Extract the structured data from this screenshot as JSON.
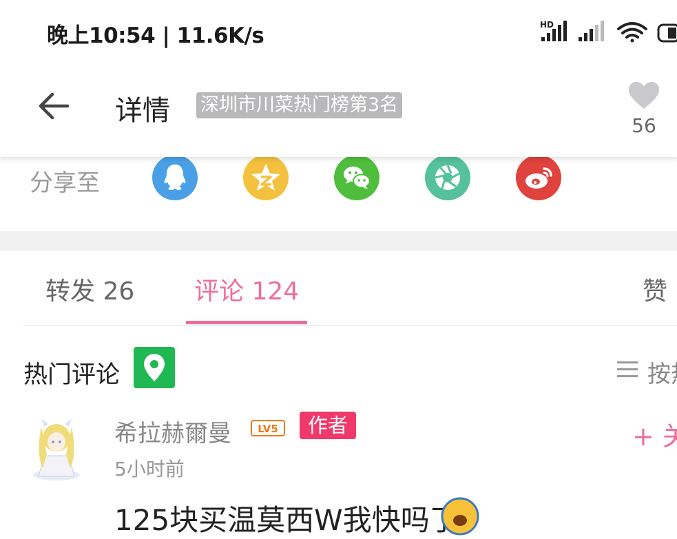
{
  "status_bar": {
    "time": "晚上10:54 | 11.6K/s",
    "hd_label": "HD",
    "icons": [
      "hd-signal-icon",
      "signal-icon",
      "wifi-icon",
      "battery-icon"
    ]
  },
  "header": {
    "title": "详情",
    "rank_badge": "深圳市川菜热门榜第3名",
    "like_count": "56",
    "icons": [
      "back-arrow-icon",
      "heart-icon"
    ]
  },
  "share": {
    "label": "分享至",
    "targets": [
      {
        "name": "QQ",
        "color": "#4aa0e6",
        "icon": "qq-icon"
      },
      {
        "name": "QQ空间",
        "color": "#f4c13e",
        "icon": "qzone-star-icon"
      },
      {
        "name": "微信",
        "color": "#4fbe3c",
        "icon": "wechat-icon"
      },
      {
        "name": "朋友圈",
        "color": "#55c19d",
        "icon": "moments-aperture-icon"
      },
      {
        "name": "微博",
        "color": "#e0423d",
        "icon": "weibo-icon"
      }
    ]
  },
  "tabs": {
    "repost": "转发 26",
    "comments": "评论 124",
    "likes": "赞",
    "active_color": "#ec6f98"
  },
  "hot_comments": {
    "title": "热门评论",
    "sort_label": "按热",
    "location_badge_color": "#20b852"
  },
  "comment": {
    "username": "希拉赫爾曼",
    "level": "LV5",
    "author_badge": "作者",
    "follow": "+ 关",
    "time": "5小时前",
    "text": "125块买温莫西W我快吗了",
    "author_badge_color": "#f0386a"
  }
}
